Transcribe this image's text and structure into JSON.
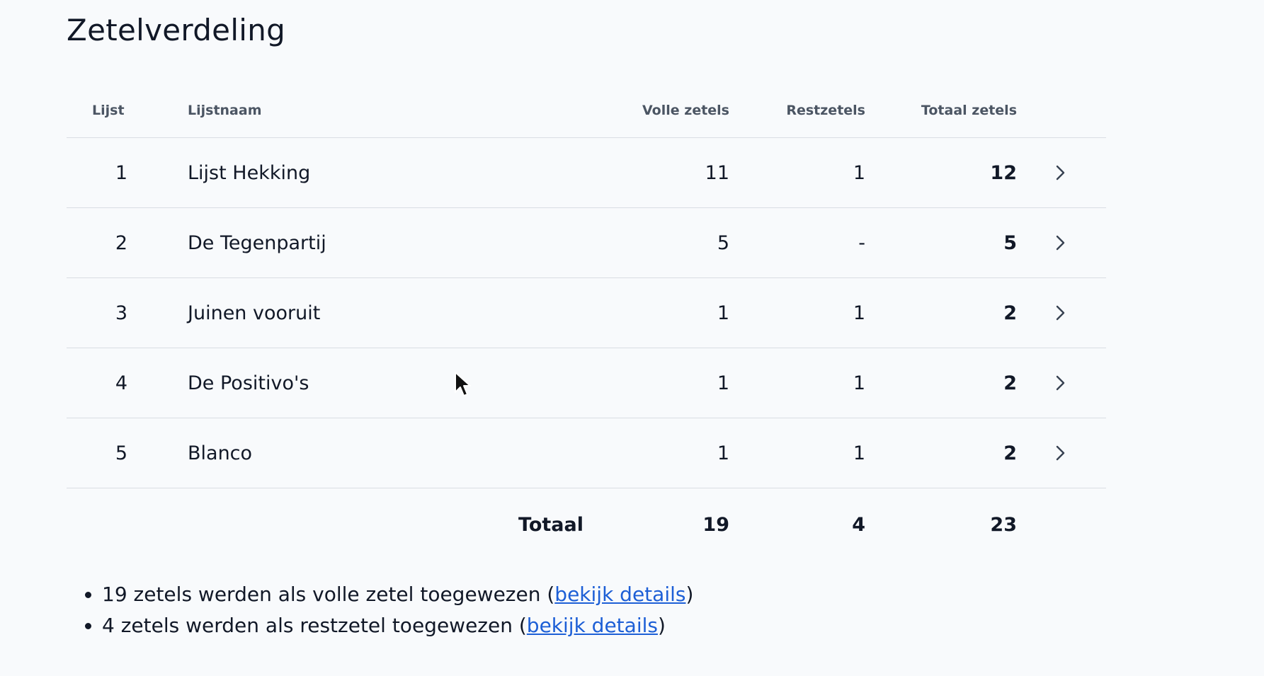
{
  "page": {
    "title": "Zetelverdeling"
  },
  "table": {
    "headers": {
      "list": "Lijst",
      "name": "Lijstnaam",
      "full": "Volle zetels",
      "rest": "Restzetels",
      "total": "Totaal zetels"
    },
    "rows": [
      {
        "list": "1",
        "name": "Lijst Hekking",
        "full": "11",
        "rest": "1",
        "total": "12"
      },
      {
        "list": "2",
        "name": "De Tegenpartij",
        "full": "5",
        "rest": "-",
        "total": "5"
      },
      {
        "list": "3",
        "name": "Juinen vooruit",
        "full": "1",
        "rest": "1",
        "total": "2"
      },
      {
        "list": "4",
        "name": "De Positivo's",
        "full": "1",
        "rest": "1",
        "total": "2"
      },
      {
        "list": "5",
        "name": "Blanco",
        "full": "1",
        "rest": "1",
        "total": "2"
      }
    ],
    "totals": {
      "label": "Totaal",
      "full": "19",
      "rest": "4",
      "total": "23"
    }
  },
  "notes": [
    {
      "before": "19 zetels werden als volle zetel toegewezen (",
      "link": "bekijk details",
      "after": ")"
    },
    {
      "before": "4 zetels werden als restzetel toegewezen (",
      "link": "bekijk details",
      "after": ")"
    }
  ],
  "icons": {
    "row_action": "chevron-right-icon",
    "pointer": "mouse-cursor-icon"
  },
  "colors": {
    "background": "#f8fafc",
    "text": "#111827",
    "header_text": "#4b5563",
    "divider": "#d9dde3",
    "link": "#1d5fd6"
  }
}
